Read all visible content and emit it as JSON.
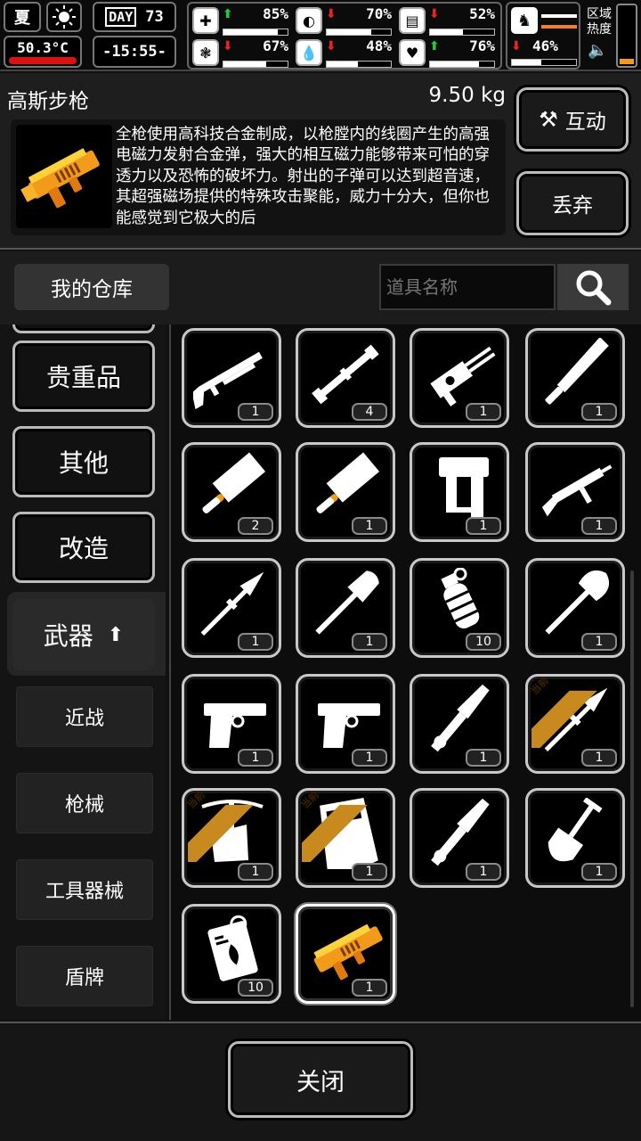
{
  "status": {
    "season": "夏",
    "temperature": "50.3°C",
    "day_label": "DAY",
    "day": "73",
    "time": "-15:55-",
    "stats": [
      {
        "name": "health",
        "icon": "medkit-icon",
        "trend": "up",
        "value": "85%",
        "level": 0.85
      },
      {
        "name": "hunger",
        "icon": "stomach-icon",
        "trend": "down",
        "value": "70%",
        "level": 0.7
      },
      {
        "name": "thirst",
        "icon": "bottle-icon",
        "trend": "down",
        "value": "52%",
        "level": 0.52
      },
      {
        "name": "sanity",
        "icon": "brain-icon",
        "trend": "down",
        "value": "67%",
        "level": 0.67
      },
      {
        "name": "hydration",
        "icon": "water-drop-icon",
        "trend": "down",
        "value": "48%",
        "level": 0.48
      },
      {
        "name": "mood",
        "icon": "heart-icon",
        "trend": "up",
        "value": "76%",
        "level": 0.76
      },
      {
        "name": "stamina",
        "icon": "leg-icon",
        "trend": "down",
        "value": "46%",
        "level": 0.46
      }
    ],
    "zone_heat_label": "区域热度"
  },
  "item": {
    "name": "高斯步枪",
    "weight": "9.50 kg",
    "description": "全枪使用高科技合金制成，以枪膛内的线圈产生的高强电磁力发射合金弹，强大的相互磁力能够带来可怕的穿透力以及恐怖的破坏力。射出的子弹可以达到超音速，其超强磁场提供的特殊攻击聚能，威力十分大，但你也能感觉到它极大的后",
    "interact_label": "互动",
    "discard_label": "丢弃"
  },
  "warehouse": {
    "title": "我的仓库",
    "search_placeholder": "道具名称"
  },
  "categories": [
    {
      "label": "贵重品"
    },
    {
      "label": "其他"
    },
    {
      "label": "改造"
    },
    {
      "label": "武器",
      "active": true
    }
  ],
  "subcategories": [
    "近战",
    "枪械",
    "工具器械",
    "盾牌"
  ],
  "items": [
    {
      "icon": "shotgun-icon",
      "count": "1"
    },
    {
      "icon": "pipe-icon",
      "count": "4"
    },
    {
      "icon": "minigun-icon",
      "count": "1"
    },
    {
      "icon": "machete-icon",
      "count": "1"
    },
    {
      "icon": "cleaver-icon",
      "count": "2"
    },
    {
      "icon": "cleaver-icon",
      "count": "1"
    },
    {
      "icon": "nail-gun-icon",
      "count": "1"
    },
    {
      "icon": "smg-icon",
      "count": "1"
    },
    {
      "icon": "spear-icon",
      "count": "1"
    },
    {
      "icon": "shovel-icon",
      "count": "1"
    },
    {
      "icon": "grenade-icon",
      "count": "10"
    },
    {
      "icon": "axe-icon",
      "count": "1"
    },
    {
      "icon": "pistol-icon",
      "count": "1"
    },
    {
      "icon": "pistol-icon",
      "count": "1"
    },
    {
      "icon": "wrench-knife-icon",
      "count": "1"
    },
    {
      "icon": "spear-icon",
      "count": "1",
      "badge": "当前"
    },
    {
      "icon": "crossbow-icon",
      "count": "1",
      "badge": "当前"
    },
    {
      "icon": "riot-shield-icon",
      "count": "1",
      "badge": "当前"
    },
    {
      "icon": "wrench-knife-icon",
      "count": "1"
    },
    {
      "icon": "spade-icon",
      "count": "1"
    },
    {
      "icon": "incendiary-pack-icon",
      "count": "10"
    },
    {
      "icon": "gauss-rifle-icon",
      "count": "1",
      "selected": true
    }
  ],
  "footer": {
    "close_label": "关闭"
  },
  "colors": {
    "accent_orange": "#f29a1a",
    "badge_gold": "#c8891e",
    "up": "#22cc33",
    "down": "#ee2222"
  }
}
